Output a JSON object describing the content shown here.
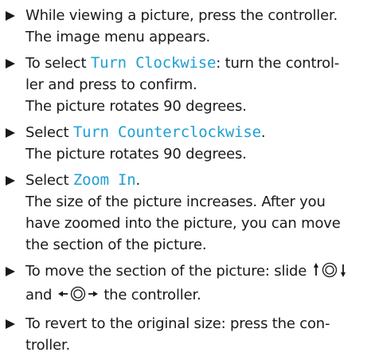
{
  "steps": [
    {
      "instruction": "While viewing a picture, press the controller.",
      "result": "The image menu appears."
    },
    {
      "pre": "To select ",
      "term": "Turn Clockwise",
      "post_line1": ": turn the control-",
      "post_line2": "ler and press to confirm.",
      "result": "The picture rotates 90 degrees."
    },
    {
      "pre": "Select ",
      "term": "Turn Counterclockwise",
      "post": ".",
      "result": "The picture rotates 90 degrees."
    },
    {
      "pre": "Select ",
      "term": "Zoom In",
      "post": ".",
      "result_line1": "The size of the picture increases. After you",
      "result_line2": "have zoomed into the picture, you can move",
      "result_line3": "the section of the picture."
    },
    {
      "pre": "To move the section of the picture: slide ",
      "mid": "and ",
      "post": " the controller."
    },
    {
      "line1": "To revert to the original size: press the con-",
      "line2": "troller."
    }
  ],
  "colors": {
    "ui_term": "#1f9fd3",
    "text": "#1a1a1a"
  },
  "icons": {
    "bullet": "right-triangle-icon",
    "slide_vertical": "controller-slide-up-down-icon",
    "slide_horizontal": "controller-slide-left-right-icon"
  }
}
